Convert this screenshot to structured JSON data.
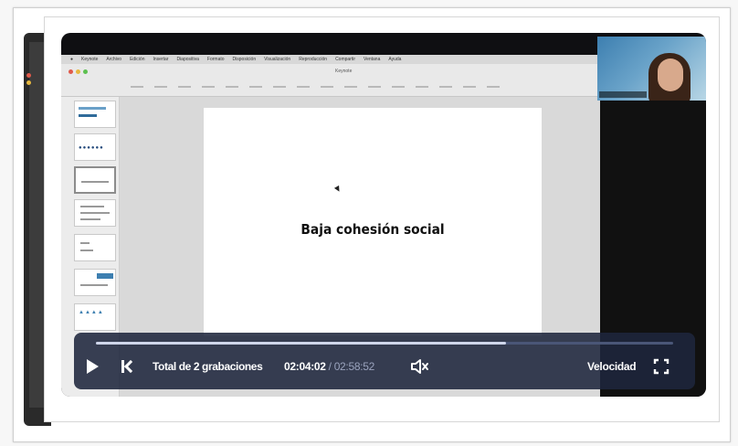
{
  "app": {
    "menu_items": [
      "Keynote",
      "Archivo",
      "Edición",
      "Insertar",
      "Diapositiva",
      "Formato",
      "Disposición",
      "Visualización",
      "Reproducción",
      "Compartir",
      "Ventana",
      "Ayuda"
    ],
    "document_title": "Keynote",
    "webcam_name": ""
  },
  "slide": {
    "title": "Baja cohesión social"
  },
  "player": {
    "recording_label": "Total de 2 grabaciones",
    "current_time": "02:04:02",
    "separator": "/",
    "duration": "02:58:52",
    "speed_label": "Velocidad",
    "progress_fraction": 0.71
  },
  "colors": {
    "control_bar": "#1e263c",
    "progress_fill": "#cfd6ea",
    "webcam_bg": "#3d7fb0"
  },
  "icons": {
    "play": "play-icon",
    "previous": "skip-previous-icon",
    "volume": "volume-muted-icon",
    "fullscreen": "fullscreen-icon"
  }
}
